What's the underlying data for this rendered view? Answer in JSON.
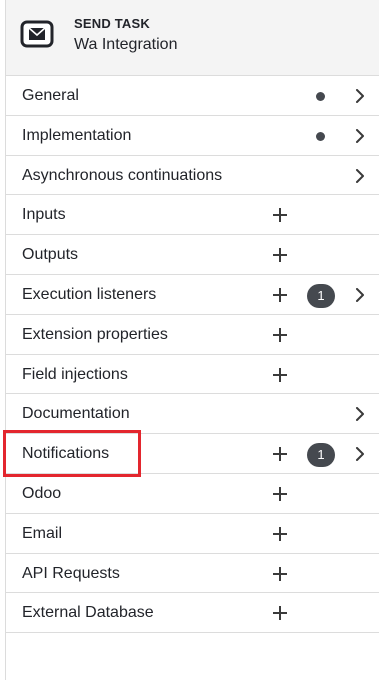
{
  "header": {
    "type_label": "SEND TASK",
    "element_name": "Wa Integration",
    "icon": "envelope-icon"
  },
  "groups": [
    {
      "id": "general",
      "label": "General",
      "has_add": false,
      "indicator": "dot",
      "badge": "",
      "has_chevron": true
    },
    {
      "id": "implementation",
      "label": "Implementation",
      "has_add": false,
      "indicator": "dot",
      "badge": "",
      "has_chevron": true
    },
    {
      "id": "asynchronous-continuations",
      "label": "Asynchronous continuations",
      "has_add": false,
      "indicator": "none",
      "badge": "",
      "has_chevron": true
    },
    {
      "id": "inputs",
      "label": "Inputs",
      "has_add": true,
      "indicator": "none",
      "badge": "",
      "has_chevron": false
    },
    {
      "id": "outputs",
      "label": "Outputs",
      "has_add": true,
      "indicator": "none",
      "badge": "",
      "has_chevron": false
    },
    {
      "id": "execution-listeners",
      "label": "Execution listeners",
      "has_add": true,
      "indicator": "badge",
      "badge": "1",
      "has_chevron": true
    },
    {
      "id": "extension-properties",
      "label": "Extension properties",
      "has_add": true,
      "indicator": "none",
      "badge": "",
      "has_chevron": false
    },
    {
      "id": "field-injections",
      "label": "Field injections",
      "has_add": true,
      "indicator": "none",
      "badge": "",
      "has_chevron": false
    },
    {
      "id": "documentation",
      "label": "Documentation",
      "has_add": false,
      "indicator": "none",
      "badge": "",
      "has_chevron": true
    },
    {
      "id": "notifications",
      "label": "Notifications",
      "has_add": true,
      "indicator": "badge",
      "badge": "1",
      "has_chevron": true
    },
    {
      "id": "odoo",
      "label": "Odoo",
      "has_add": true,
      "indicator": "none",
      "badge": "",
      "has_chevron": false
    },
    {
      "id": "email",
      "label": "Email",
      "has_add": true,
      "indicator": "none",
      "badge": "",
      "has_chevron": false
    },
    {
      "id": "api-requests",
      "label": "API Requests",
      "has_add": true,
      "indicator": "none",
      "badge": "",
      "has_chevron": false
    },
    {
      "id": "external-database",
      "label": "External Database",
      "has_add": true,
      "indicator": "none",
      "badge": "",
      "has_chevron": false
    }
  ],
  "highlight": {
    "target": "notifications",
    "color": "#e3262e"
  }
}
